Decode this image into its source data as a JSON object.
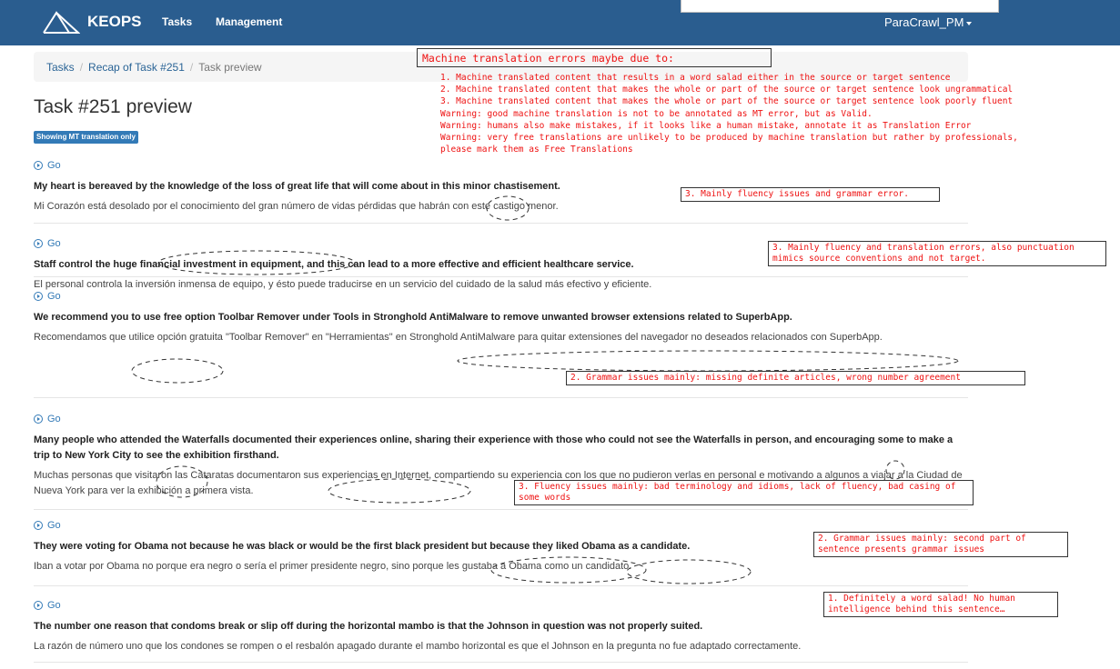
{
  "navbar": {
    "brand": "KEOPS",
    "links": [
      "Tasks",
      "Management"
    ],
    "user": "ParaCrawl_PM"
  },
  "breadcrumb": {
    "items": [
      "Tasks",
      "Recap of Task #251"
    ],
    "active": "Task preview"
  },
  "page": {
    "title": "Task #251 preview",
    "badge": "Showing MT translation only"
  },
  "go_label": "Go",
  "items": [
    {
      "source": "My heart is bereaved by the knowledge of the loss of great life that will come about in this minor chastisement.",
      "target": "Mi Corazón está desolado por el conocimiento del gran número de vidas pérdidas que habrán con este castigo menor."
    },
    {
      "source": "Staff control the huge financial investment in equipment, and this can lead to a more effective and efficient healthcare service.",
      "target": "El personal controla la inversión inmensa de equipo, y ésto puede traducirse en un servicio del cuidado de la salud más efectivo y eficiente."
    },
    {
      "source": "We recommend you to use free option Toolbar Remover under Tools in Stronghold AntiMalware to remove unwanted browser extensions related to SuperbApp.",
      "target": "Recomendamos que utilice opción gratuita \"Toolbar Remover\" en \"Herramientas\" en Stronghold AntiMalware para quitar extensiones del navegador no deseados relacionados con SuperbApp."
    },
    {
      "source": "Many people who attended the Waterfalls documented their experiences online, sharing their experience with those who could not see the Waterfalls in person, and encouraging some to make a trip to New York City to see the exhibition firsthand.",
      "target": "Muchas personas que visitaron las Cataratas documentaron sus experiencias en Internet, compartiendo su experiencia con los que no pudieron verlas en personal e motivando a algunos a viajar a la Ciudad de Nueva York para ver la exhibición a primera vista."
    },
    {
      "source": "They were voting for Obama not because he was black or would be the first black president but because they liked Obama as a candidate.",
      "target": "Iban a votar por Obama no porque era negro o sería el primer presidente negro, sino porque les gustaba a Obama como un candidato."
    },
    {
      "source": "The number one reason that condoms break or slip off during the horizontal mambo is that the Johnson in question was not properly suited.",
      "target": "La razón de número uno que los condones se rompen o el resbalón apagado durante el mambo horizontal es que el Johnson en la pregunta no fue adaptado correctamente."
    }
  ],
  "annotations": {
    "mt_title": "Machine translation errors maybe due to:",
    "mt_list": [
      "1. Machine translated content that results in a word salad either in the source or target sentence",
      "2. Machine translated content that makes the whole or part of the source or target sentence look ungrammatical",
      "3. Machine translated content that makes the whole or part of the source or target sentence look poorly fluent",
      "Warning: good machine translation is not to be annotated as MT error, but as Valid.",
      "Warning: humans also make mistakes, if it looks like a human mistake, annotate it as Translation Error",
      "Warning: very free translations are unlikely to be produced by machine translation but rather by professionals,",
      "please mark them as Free Translations"
    ],
    "notes": [
      "3. Mainly fluency issues and grammar error.",
      "3. Mainly fluency and translation errors, also punctuation mimics source conventions and not target.",
      "2. Grammar issues mainly: missing definite articles, wrong number agreement",
      "3. Fluency issues mainly: bad terminology and idioms, lack of fluency, bad casing of some words",
      "2. Grammar issues mainly: second part of sentence presents grammar issues",
      "1. Definitely a word salad! No human intelligence behind this sentence…"
    ]
  },
  "colors": {
    "navbar": "#2a5d8f",
    "link": "#337ab7",
    "annotation": "#ee1111"
  }
}
